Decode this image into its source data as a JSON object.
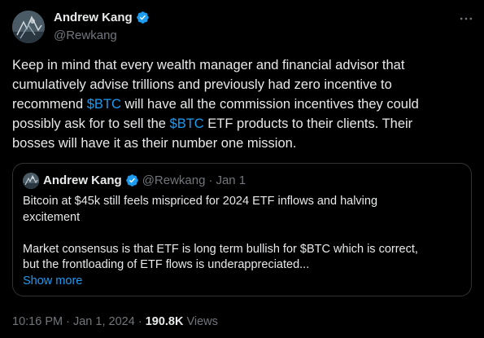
{
  "author": {
    "name": "Andrew Kang",
    "handle": "@Rewkang",
    "verified_icon": "verified-badge-icon",
    "more_icon": "more-options-icon"
  },
  "tweet": {
    "lines": [
      [
        "Keep in mind that every wealth manager and financial advisor that"
      ],
      [
        "cumulatively advise trillions and previously had zero incentive to"
      ],
      [
        "recommend ",
        "$BTC",
        " will have all the commission incentives they could"
      ],
      [
        "possibly ask for to sell the ",
        "$BTC",
        " ETF products to their clients. Their"
      ],
      [
        "bosses will have it as their number one mission."
      ]
    ]
  },
  "quote": {
    "name": "Andrew Kang",
    "handle": "@Rewkang",
    "separator": "·",
    "date": "Jan 1",
    "line1": "Bitcoin at $45k still feels mispriced for 2024 ETF inflows and halving",
    "line2": "excitement",
    "line3": "Market consensus is that ETF is long term bullish for $BTC which is correct,",
    "line4": "but the frontloading of ETF flows is underappreciated...",
    "show_more": "Show more"
  },
  "meta": {
    "time": "10:16 PM",
    "separator1": "·",
    "date": "Jan 1, 2024",
    "separator2": "·",
    "views_count": "190.8K",
    "views_label": "Views"
  },
  "colors": {
    "background": "#000000",
    "text": "#e7e9ea",
    "muted": "#71767b",
    "link": "#1d9bf0",
    "border": "#2f3336",
    "verified": "#1d9bf0"
  }
}
